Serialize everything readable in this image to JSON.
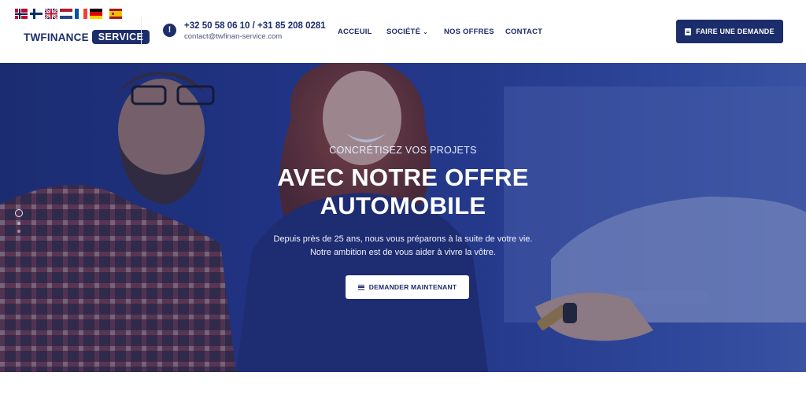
{
  "header": {
    "flags": [
      "Norway",
      "Finland",
      "United Kingdom",
      "Netherlands",
      "France",
      "Germany",
      "Spain"
    ],
    "logo": {
      "word": "TWFINANCE",
      "badge": "SERVICE"
    },
    "contact": {
      "icon": "info-icon",
      "phone": "+32 50 58 06 10 / +31 85 208 0281",
      "email": "contact@twfinan-service.com"
    },
    "nav": {
      "items": [
        "ACCEUIL",
        "SOCIÉTÉ",
        "NOS OFFRES",
        "CONTACT"
      ],
      "dropdown_icon": "chevron-down-icon"
    },
    "cta_label": "FAIRE UNE DEMANDE",
    "cta_icon": "document-icon"
  },
  "hero": {
    "subtitle": "CONCRÉTISEZ VOS PROJETS",
    "title_line1": "AVEC NOTRE OFFRE",
    "title_line2": "AUTOMOBILE",
    "desc_line1": "Depuis près de 25 ans, nous vous préparons à la suite de votre vie.",
    "desc_line2": "Notre ambition est de vous aider à vivre la vôtre.",
    "button_label": "DEMANDER MAINTENANT",
    "button_icon": "menu-icon",
    "slides": {
      "count": 3,
      "active": 1
    }
  },
  "colors": {
    "brand_navy": "#1c2d6b",
    "hero_blue": "#2a4096",
    "white": "#ffffff"
  }
}
